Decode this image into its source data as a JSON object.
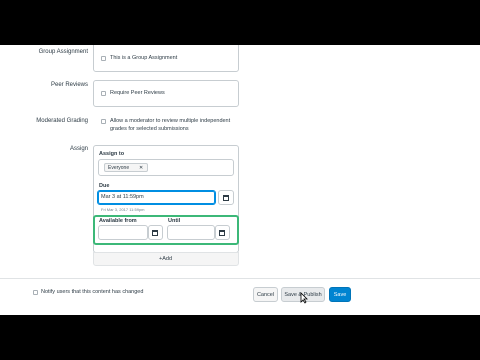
{
  "group_assignment": {
    "label": "Group Assignment",
    "checkbox_text": "This is a Group Assignment"
  },
  "peer_reviews": {
    "label": "Peer Reviews",
    "checkbox_text": "Require Peer Reviews"
  },
  "moderated_grading": {
    "label": "Moderated Grading",
    "checkbox_text_line1": "Allow a moderator to review multiple independent",
    "checkbox_text_line2": "grades for selected submissions"
  },
  "assign": {
    "label": "Assign",
    "assign_to_label": "Assign to",
    "token": "Everyone",
    "token_remove": "✕",
    "due_label": "Due",
    "due_value": "Mar 3 at 11:59pm",
    "due_hint": "Fri Mar 3, 2017 11:59pm",
    "available_from_label": "Available from",
    "until_label": "Until",
    "available_from_value": "",
    "until_value": "",
    "add_label": "+Add"
  },
  "footer": {
    "notify_text": "Notify users that this content has changed",
    "cancel_label": "Cancel",
    "save_publish_label": "Save & Publish",
    "save_label": "Save"
  },
  "colors": {
    "highlight": "#3cb878",
    "primary": "#0084d1",
    "focus": "#008ee2"
  }
}
